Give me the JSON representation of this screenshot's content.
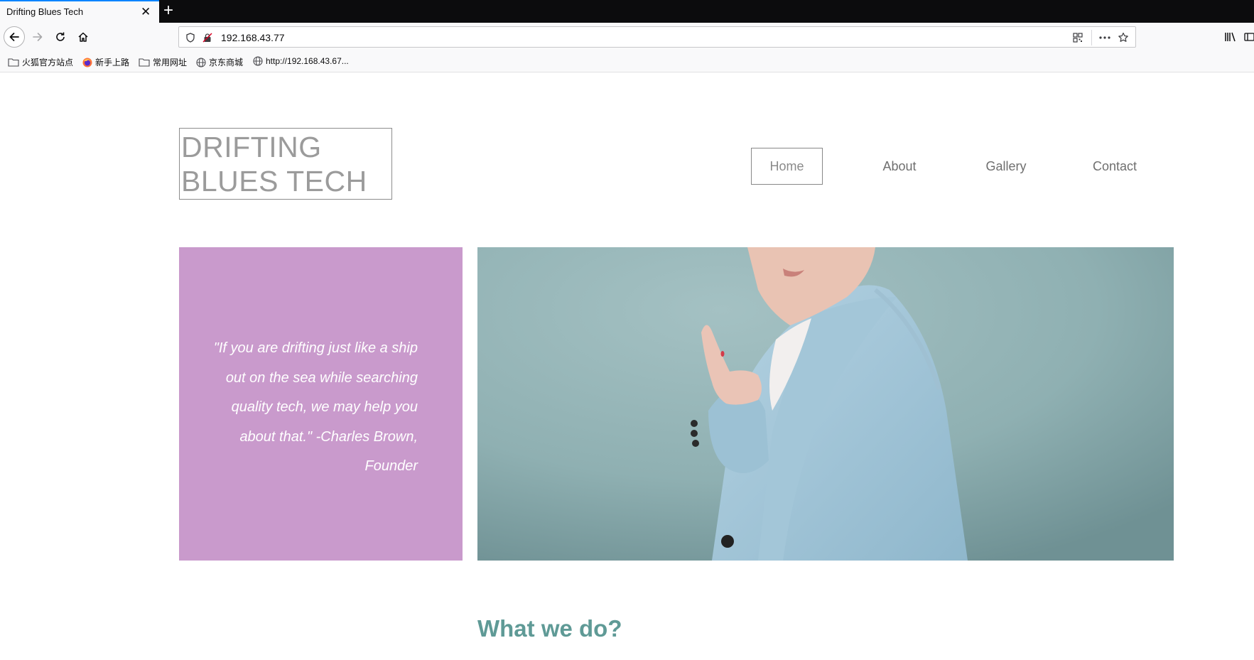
{
  "browser": {
    "tab_title": "Drifting Blues Tech",
    "tab_close": "✕",
    "new_tab": "+",
    "url": "192.168.43.77",
    "bookmarks": [
      {
        "label": "火狐官方站点",
        "icon": "folder-icon"
      },
      {
        "label": "新手上路",
        "icon": "firefox-icon"
      },
      {
        "label": "常用网址",
        "icon": "folder-icon"
      },
      {
        "label": "京东商城",
        "icon": "globe-icon"
      },
      {
        "label": "http://192.168.43.67...",
        "icon": "globe-icon"
      }
    ]
  },
  "site": {
    "logo": "DRIFTING BLUES TECH",
    "nav": [
      {
        "label": "Home",
        "active": true
      },
      {
        "label": "About"
      },
      {
        "label": "Gallery"
      },
      {
        "label": "Contact"
      }
    ],
    "quote": "\"If you are drifting just like a ship out on the sea while searching quality tech, we may help you about that.\" -Charles Brown, Founder",
    "section_title": "What we do?"
  },
  "colors": {
    "quote_bg": "#c99acc",
    "hero_bg": "#8fb0b2",
    "title_color": "#5f9a96",
    "tab_accent": "#0a84ff"
  }
}
